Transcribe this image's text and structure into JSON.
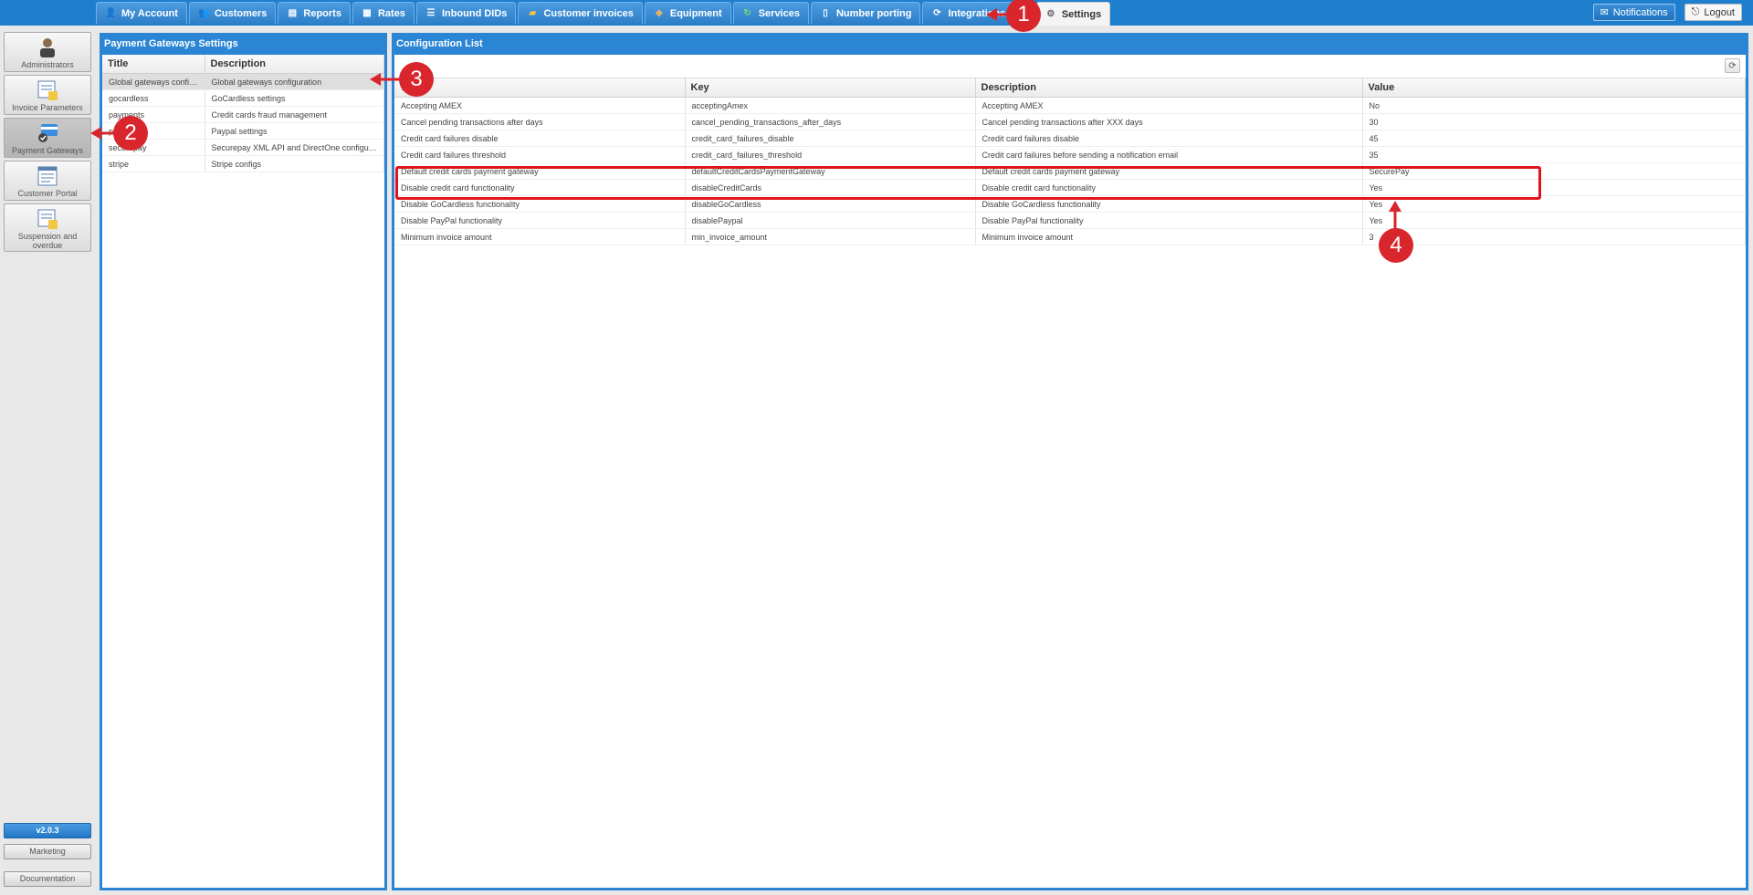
{
  "nav": {
    "tabs": [
      {
        "label": "My Account",
        "icon": "user-icon"
      },
      {
        "label": "Customers",
        "icon": "customers-icon"
      },
      {
        "label": "Reports",
        "icon": "reports-icon"
      },
      {
        "label": "Rates",
        "icon": "rates-icon"
      },
      {
        "label": "Inbound DIDs",
        "icon": "dids-icon"
      },
      {
        "label": "Customer invoices",
        "icon": "invoices-icon"
      },
      {
        "label": "Equipment",
        "icon": "equipment-icon"
      },
      {
        "label": "Services",
        "icon": "services-icon"
      },
      {
        "label": "Number porting",
        "icon": "porting-icon"
      },
      {
        "label": "Integrations/API",
        "icon": "integrations-icon"
      },
      {
        "label": "Settings",
        "icon": "gear-icon"
      }
    ],
    "notifications_label": "Notifications",
    "logout_label": "Logout"
  },
  "sidebar": {
    "items": [
      {
        "label": "Administrators",
        "icon": "administrator-icon"
      },
      {
        "label": "Invoice Parameters",
        "icon": "invoice-parameters-icon"
      },
      {
        "label": "Payment Gateways",
        "icon": "payment-gateways-icon"
      },
      {
        "label": "Customer Portal",
        "icon": "customer-portal-icon"
      },
      {
        "label": "Suspension and overdue",
        "icon": "suspension-icon"
      }
    ],
    "version": "v2.0.3",
    "marketing_label": "Marketing",
    "documentation_label": "Documentation"
  },
  "gateways": {
    "title": "Payment Gateways Settings",
    "columns": [
      "Title",
      "Description"
    ],
    "rows": [
      [
        "Global gateways config...",
        "Global gateways configuration"
      ],
      [
        "gocardless",
        "GoCardless settings"
      ],
      [
        "payments",
        "Credit cards fraud management"
      ],
      [
        "paypal",
        "Paypal settings"
      ],
      [
        "securepay",
        "Securepay XML API and DirectOne configurati..."
      ],
      [
        "stripe",
        "Stripe configs"
      ]
    ]
  },
  "config": {
    "title": "Configuration List",
    "columns": [
      "Title",
      "Key",
      "Description",
      "Value"
    ],
    "rows": [
      [
        "Accepting AMEX",
        "acceptingAmex",
        "Accepting AMEX",
        "No"
      ],
      [
        "Cancel pending transactions after days",
        "cancel_pending_transactions_after_days",
        "Cancel pending transactions after XXX days",
        "30"
      ],
      [
        "Credit card failures disable",
        "credit_card_failures_disable",
        "Credit card failures disable",
        "45"
      ],
      [
        "Credit card failures threshold",
        "credit_card_failures_threshold",
        "Credit card failures before sending a notification email",
        "35"
      ],
      [
        "Default credit cards payment gateway",
        "defaultCreditCardsPaymentGateway",
        "Default credit cards payment gateway",
        "SecurePay"
      ],
      [
        "Disable credit card functionality",
        "disableCreditCards",
        "Disable credit card functionality",
        "Yes"
      ],
      [
        "Disable GoCardless functionality",
        "disableGoCardless",
        "Disable GoCardless functionality",
        "Yes"
      ],
      [
        "Disable PayPal functionality",
        "disablePaypal",
        "Disable PayPal functionality",
        "Yes"
      ],
      [
        "Minimum invoice amount",
        "min_invoice_amount",
        "Minimum invoice amount",
        "3"
      ]
    ]
  },
  "annotations": [
    "1",
    "2",
    "3",
    "4"
  ],
  "colors": {
    "accent": "#2a86d4",
    "annotation": "#d9262c"
  }
}
